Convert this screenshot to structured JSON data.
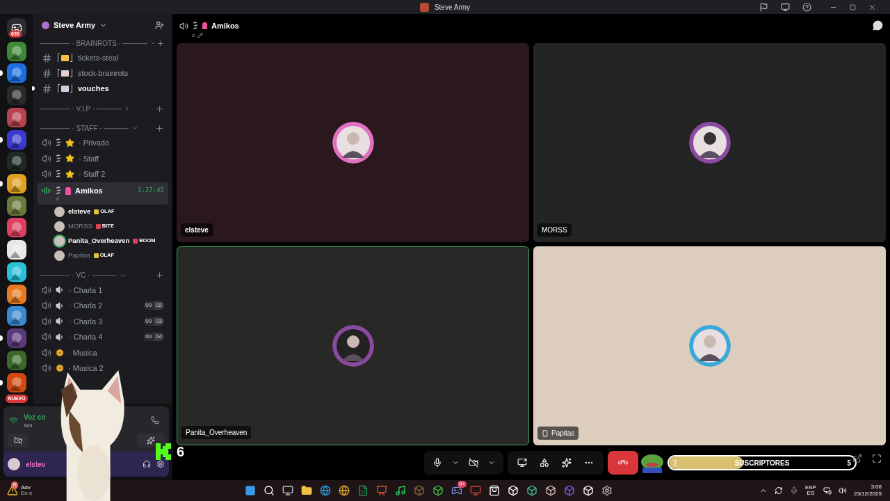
{
  "window": {
    "title": "Steve Army"
  },
  "rail": {
    "home_badge": "630",
    "new_badge": "NUEVO",
    "servers": [
      {
        "color": "#3f8a3a",
        "unread": false
      },
      {
        "color": "#1d6fe0",
        "unread": true
      },
      {
        "color": "#2a2a2a",
        "unread": false
      },
      {
        "color": "#b8434f",
        "unread": false
      },
      {
        "color": "#3a3ad0",
        "unread": true
      },
      {
        "color": "#1f2a24",
        "unread": false
      },
      {
        "color": "#e0a020",
        "unread": true
      },
      {
        "color": "#6a7a3a",
        "unread": false
      },
      {
        "color": "#e04060",
        "unread": false
      },
      {
        "color": "#e8e8e8",
        "unread": false
      },
      {
        "color": "#2ac0d8",
        "unread": false
      },
      {
        "color": "#e87a20",
        "unread": false
      },
      {
        "color": "#3a8ad0",
        "unread": false
      },
      {
        "color": "#5a3a7a",
        "unread": true
      },
      {
        "color": "#3a6a2a",
        "unread": false
      },
      {
        "color": "#d04a10",
        "unread": true
      }
    ]
  },
  "server_name": "Steve Army",
  "channels": [
    {
      "kind": "category",
      "label": "────── · BRAINROTS · ─────",
      "expanded": true
    },
    {
      "kind": "text",
      "name": "tickets-steal",
      "unread": false
    },
    {
      "kind": "text",
      "name": "stock-brainrots",
      "unread": false
    },
    {
      "kind": "text",
      "name": "vouches",
      "unread": true
    },
    {
      "kind": "category",
      "label": "────── · V.I.P · ─────",
      "expanded": false
    },
    {
      "kind": "category",
      "label": "────── · STAFF · ─────",
      "expanded": true
    },
    {
      "kind": "starvoice",
      "name": "· Privado",
      "selected": false
    },
    {
      "kind": "starvoice",
      "name": "· Staff",
      "selected": false
    },
    {
      "kind": "starvoice",
      "name": "· Staff 2",
      "selected": false
    },
    {
      "kind": "callvoice",
      "name": "Amikos",
      "selected": true,
      "timer": "1:27:45",
      "status": "si"
    },
    {
      "kind": "user",
      "name": "elsteve",
      "tag": "OLAF",
      "color": "#e0c040",
      "active": true,
      "speaking": false
    },
    {
      "kind": "user",
      "name": "MORSS",
      "tag": "BITE",
      "color": "#e04050",
      "active": false,
      "speaking": false
    },
    {
      "kind": "user",
      "name": "Panita_Overheaven",
      "tag": "BOOM",
      "color": "#e04060",
      "active": true,
      "speaking": true
    },
    {
      "kind": "user",
      "name": "Papitas",
      "tag": "OLAF",
      "color": "#e0c040",
      "active": false,
      "speaking": false
    },
    {
      "kind": "category",
      "label": "────── · VC · ─────",
      "expanded": true
    },
    {
      "kind": "speakervoice",
      "name": "· Charla 1",
      "selected": false
    },
    {
      "kind": "speakervoice",
      "name": "· Charla 2",
      "selected": false,
      "count": [
        "00",
        "02"
      ]
    },
    {
      "kind": "speakervoice",
      "name": "· Charla 3",
      "selected": false,
      "count": [
        "00",
        "03"
      ]
    },
    {
      "kind": "speakervoice",
      "name": "· Charla 4",
      "selected": false,
      "count": [
        "00",
        "04"
      ]
    },
    {
      "kind": "discvoice",
      "name": "· Musica",
      "selected": false
    },
    {
      "kind": "discvoice",
      "name": "· Musica 2",
      "selected": false
    }
  ],
  "voice_panel": {
    "status": "Voz co",
    "channel": "Ami"
  },
  "user_panel": {
    "name": "elstev"
  },
  "call": {
    "channel": "Amikos",
    "status": "si",
    "tiles": [
      {
        "name": "elsteve",
        "speaking": false,
        "mobile": false
      },
      {
        "name": "MORSS",
        "speaking": false,
        "mobile": false
      },
      {
        "name": "Panita_Overheaven",
        "speaking": true,
        "mobile": false
      },
      {
        "name": "Papitas",
        "speaking": false,
        "mobile": true
      }
    ]
  },
  "overlay": {
    "kick_count": "6",
    "sub_start": "2",
    "sub_label": "SUSCRIPTORES",
    "sub_goal": "5",
    "level": 0.4
  },
  "taskbar": {
    "notice_badge": "5",
    "notice_title": "Adv",
    "notice_sub": "En e",
    "lang": "ESP",
    "lang_sub": "ES",
    "time": "3:06",
    "date": "23/12/2025",
    "discord_badge": "9+"
  }
}
